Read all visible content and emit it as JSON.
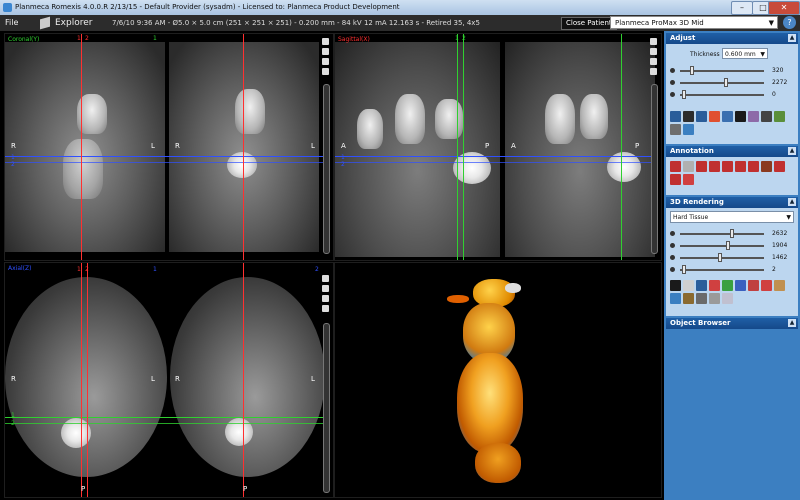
{
  "window": {
    "title": "Planmeca Romexis 4.0.0.R  2/13/15 - Default Provider (sysadm) - Licensed to: Planmeca Product Development",
    "min": "–",
    "max": "□",
    "close": "✕"
  },
  "menu": {
    "file": "File",
    "explorer": "Explorer",
    "info": "7/6/10 9:36 AM - Ø5.0 × 5.0 cm (251 × 251 × 251) - 0.200 mm - 84 kV 12 mA 12.163 s - Retired 35, 4x5",
    "close_patient": "Close Patient",
    "device": "Planmeca ProMax 3D Mid",
    "help": "?"
  },
  "views": {
    "coronal": {
      "label": "Coronal(Y)",
      "top_nums": [
        "1",
        "2",
        "1"
      ],
      "left": "R",
      "right": "L",
      "side_nums": [
        "1",
        "2"
      ]
    },
    "sagittal": {
      "label": "Sagittal(X)",
      "top_nums": [
        "1",
        "2"
      ],
      "left": "A",
      "right": "P",
      "side_nums": [
        "1",
        "2"
      ]
    },
    "axial": {
      "label": "Axial(Z)",
      "top_nums": [
        "1",
        "2",
        "1",
        "2"
      ],
      "left": "R",
      "right": "L",
      "bottom": "P",
      "side_nums": [
        "1",
        "2"
      ]
    }
  },
  "panel": {
    "adjust": {
      "title": "Adjust",
      "thickness_label": "Thickness",
      "thickness_value": "0.600 mm",
      "sliders": [
        {
          "value": "320",
          "pos": 0.12
        },
        {
          "value": "2272",
          "pos": 0.55
        },
        {
          "value": "0",
          "pos": 0.02
        }
      ]
    },
    "annotation": {
      "title": "Annotation"
    },
    "rendering": {
      "title": "3D Rendering",
      "preset": "Hard Tissue",
      "sliders": [
        {
          "value": "2632",
          "pos": 0.62
        },
        {
          "value": "1904",
          "pos": 0.58
        },
        {
          "value": "1462",
          "pos": 0.48
        },
        {
          "value": "2",
          "pos": 0.02
        }
      ]
    },
    "object_browser": {
      "title": "Object Browser"
    },
    "header_button": "▲"
  },
  "colors": {
    "red": "#ff3030",
    "green": "#30d030",
    "blue": "#3050ff",
    "panel_bg": "#3c7fc1",
    "panel_body": "#bcd6ef",
    "header": "#15498a"
  }
}
